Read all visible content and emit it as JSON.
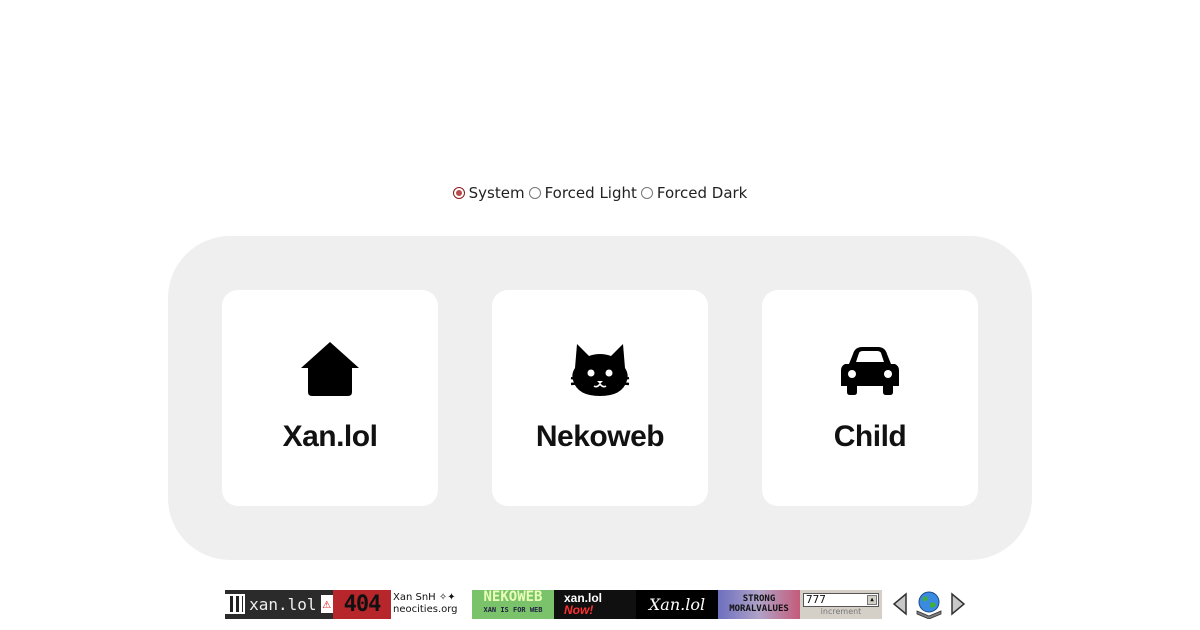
{
  "theme_switch": {
    "options": [
      {
        "label": "System",
        "selected": true
      },
      {
        "label": "Forced Light",
        "selected": false
      },
      {
        "label": "Forced Dark",
        "selected": false
      }
    ]
  },
  "cards": [
    {
      "label": "Xan.lol",
      "icon": "house-icon"
    },
    {
      "label": "Nekoweb",
      "icon": "cat-icon"
    },
    {
      "label": "Child",
      "icon": "car-icon"
    }
  ],
  "badges": {
    "xan": {
      "text": "xan.lol",
      "warning": "⚠"
    },
    "notfound": {
      "text": "404"
    },
    "neocities": {
      "line1": "Xan SnH ✧✦",
      "line2": "neocities.org"
    },
    "nekoweb": {
      "text": "NEKOWEB",
      "sub": "XAN IS FOR WEB"
    },
    "now": {
      "line1": "xan.lol",
      "line2": "Now!"
    },
    "script": {
      "text": "Xan.lol"
    },
    "moral": {
      "line1": "STRONG",
      "line2": "MORALVALUES"
    },
    "counter": {
      "value": "777",
      "sub": "increment"
    }
  },
  "colors": {
    "panel": "#efefef",
    "card": "#ffffff",
    "radio_accent": "#b94a4a"
  }
}
